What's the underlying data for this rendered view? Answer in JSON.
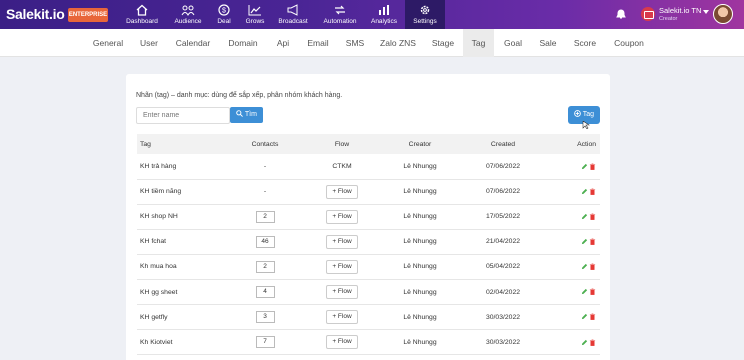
{
  "brand": {
    "logo": "Salekit.io",
    "badge": "ENTERPRISE"
  },
  "nav": [
    {
      "label": "Dashboard",
      "icon": "home-icon"
    },
    {
      "label": "Audience",
      "icon": "audience-icon"
    },
    {
      "label": "Deal",
      "icon": "deal-icon"
    },
    {
      "label": "Grows",
      "icon": "grows-icon"
    },
    {
      "label": "Broadcast",
      "icon": "megaphone-icon"
    },
    {
      "label": "Automation",
      "icon": "automation-icon"
    },
    {
      "label": "Analytics",
      "icon": "analytics-icon"
    },
    {
      "label": "Settings",
      "icon": "gear-icon"
    }
  ],
  "user": {
    "name": "Salekit.io TN",
    "role": "Creator"
  },
  "tabs": [
    "General",
    "User",
    "Calendar",
    "Domain",
    "Api",
    "Email",
    "SMS",
    "Zalo ZNS",
    "Stage",
    "Tag",
    "Goal",
    "Sale",
    "Score",
    "Coupon"
  ],
  "page": {
    "description": "Nhãn (tag) – danh mục: dùng để sắp xếp, phân nhóm khách hàng.",
    "search_placeholder": "Enter name",
    "search_button": "Tìm",
    "add_button": "Tag"
  },
  "table": {
    "headers": [
      "Tag",
      "Contacts",
      "Flow",
      "Creator",
      "Created",
      "Action"
    ],
    "rows": [
      {
        "tag": "KH trả hàng",
        "contacts": "-",
        "flow": "CTKM",
        "creator": "Lê Nhungg",
        "created": "07/06/2022"
      },
      {
        "tag": "KH tiềm năng",
        "contacts": "-",
        "flow": "+ Flow",
        "creator": "Lê Nhungg",
        "created": "07/06/2022"
      },
      {
        "tag": "KH shop NH",
        "contacts": "2",
        "flow": "+ Flow",
        "creator": "Lê Nhungg",
        "created": "17/05/2022"
      },
      {
        "tag": "KH fchat",
        "contacts": "46",
        "flow": "+ Flow",
        "creator": "Lê Nhungg",
        "created": "21/04/2022"
      },
      {
        "tag": "Kh mua hoa",
        "contacts": "2",
        "flow": "+ Flow",
        "creator": "Lê Nhungg",
        "created": "05/04/2022"
      },
      {
        "tag": "KH gg sheet",
        "contacts": "4",
        "flow": "+ Flow",
        "creator": "Lê Nhungg",
        "created": "02/04/2022"
      },
      {
        "tag": "KH getfly",
        "contacts": "3",
        "flow": "+ Flow",
        "creator": "Lê Nhungg",
        "created": "30/03/2022"
      },
      {
        "tag": "Kh Kiotviet",
        "contacts": "7",
        "flow": "+ Flow",
        "creator": "Lê Nhungg",
        "created": "30/03/2022"
      }
    ]
  },
  "colors": {
    "primary": "#3d8fd6",
    "edit": "#4caf50",
    "delete": "#e53935",
    "topbar": "#4a2595"
  }
}
